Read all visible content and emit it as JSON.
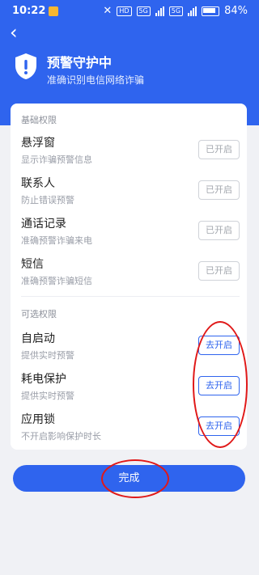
{
  "status": {
    "time": "10:22",
    "battery": "84%",
    "net1": "HD",
    "net2": "5G",
    "net3": "5G"
  },
  "header": {
    "title": "预警守护中",
    "subtitle": "准确识别电信网络诈骗"
  },
  "basic": {
    "title": "基础权限",
    "items": [
      {
        "name": "悬浮窗",
        "desc": "显示诈骗预警信息",
        "button": "已开启"
      },
      {
        "name": "联系人",
        "desc": "防止错误预警",
        "button": "已开启"
      },
      {
        "name": "通话记录",
        "desc": "准确预警诈骗来电",
        "button": "已开启"
      },
      {
        "name": "短信",
        "desc": "准确预警诈骗短信",
        "button": "已开启"
      }
    ]
  },
  "optional": {
    "title": "可选权限",
    "items": [
      {
        "name": "自启动",
        "desc": "提供实时预警",
        "button": "去开启"
      },
      {
        "name": "耗电保护",
        "desc": "提供实时预警",
        "button": "去开启"
      },
      {
        "name": "应用锁",
        "desc": "不开启影响保护时长",
        "button": "去开启"
      }
    ]
  },
  "done_label": "完成",
  "colors": {
    "primary": "#2f64ee",
    "annotation": "#e01818"
  }
}
